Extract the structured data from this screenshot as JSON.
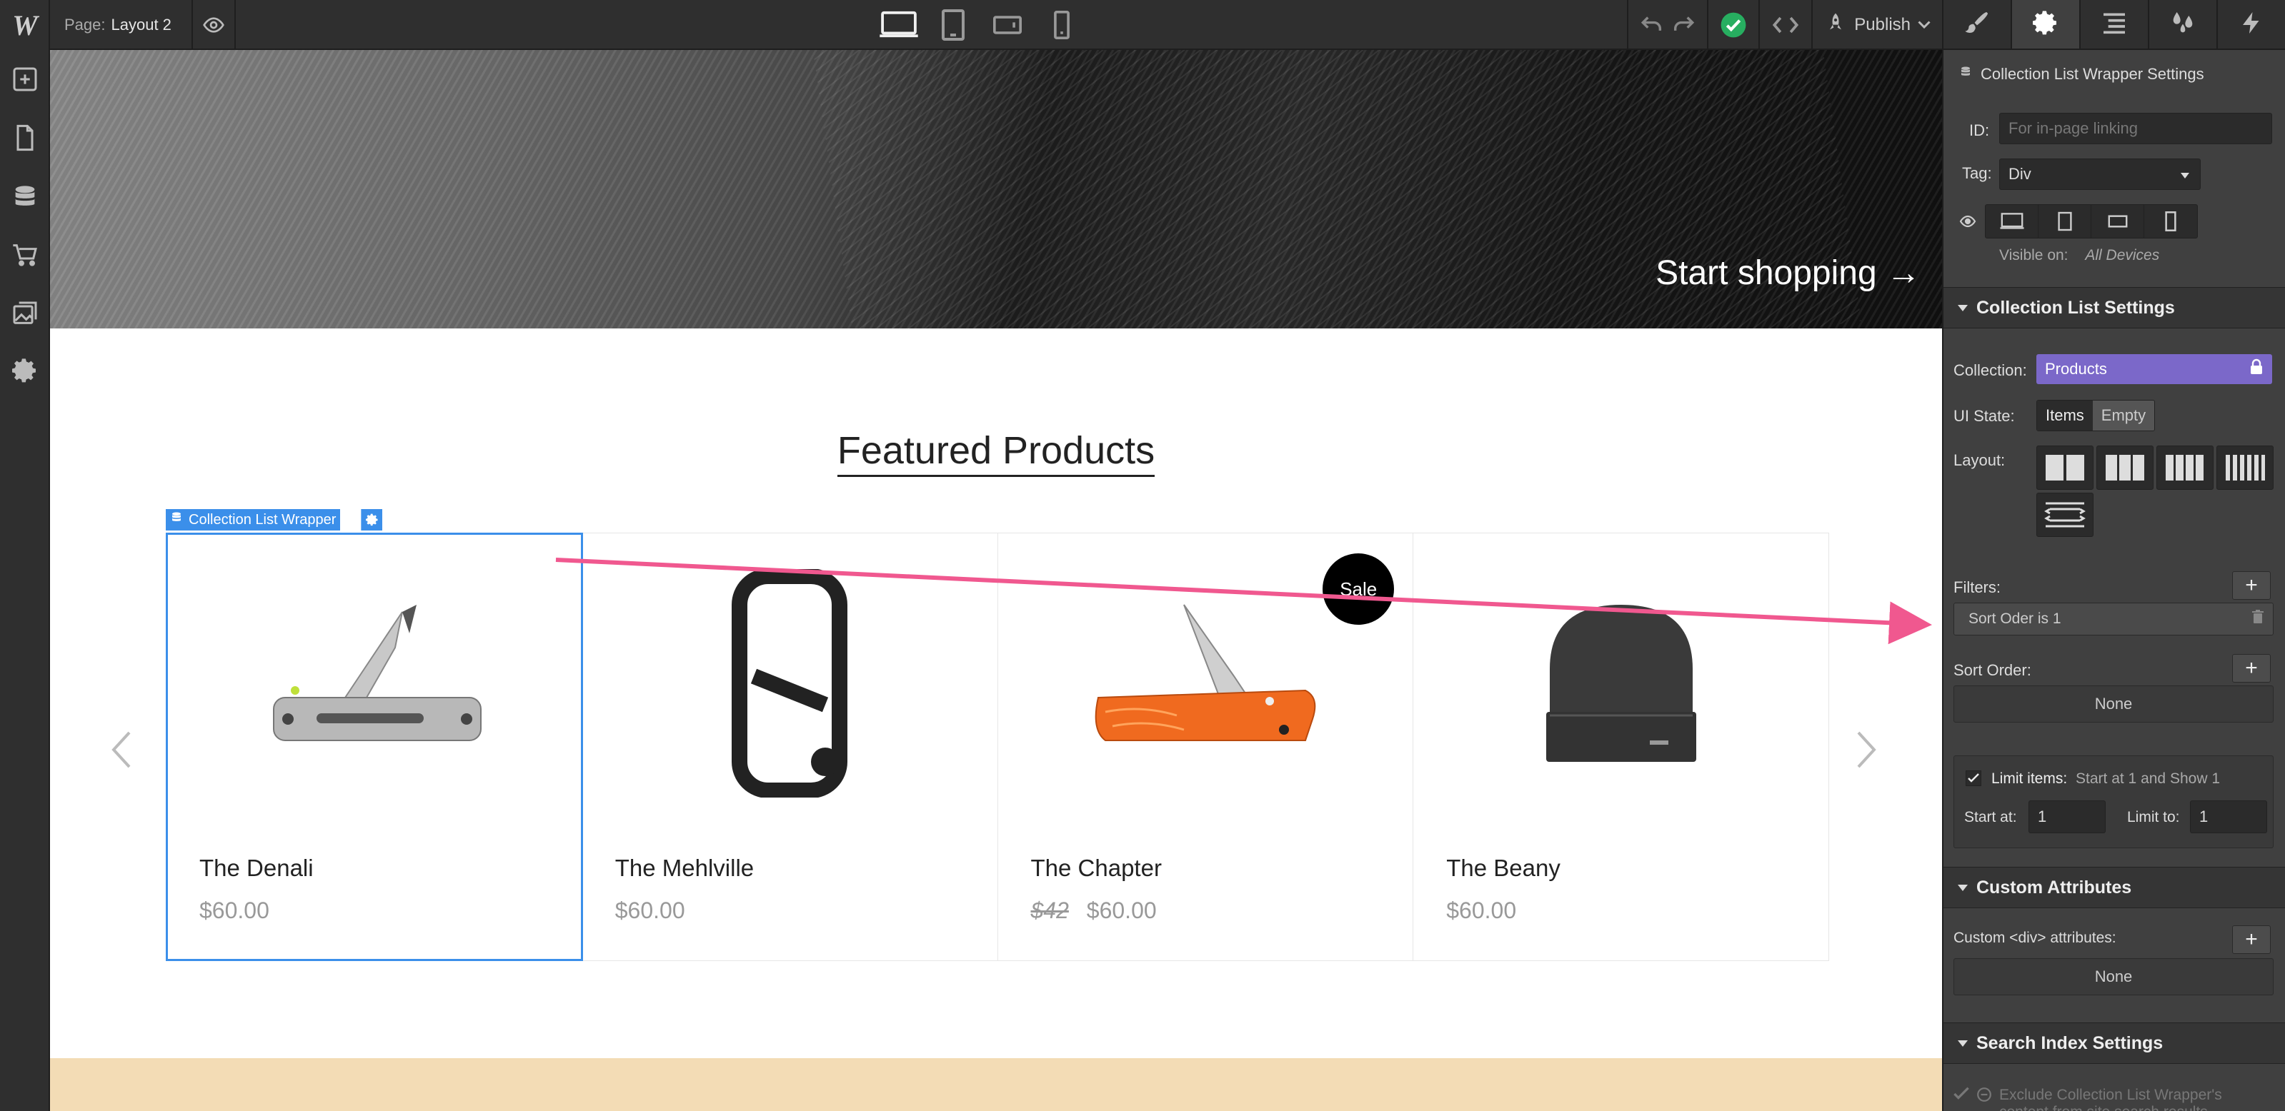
{
  "topbar": {
    "page_label": "Page:",
    "page_name": "Layout 2",
    "publish_label": "Publish"
  },
  "canvas": {
    "hero_cta": "Start shopping →",
    "section_title": "Featured Products",
    "selection_label": "Collection List Wrapper",
    "products": [
      {
        "name": "The Denali",
        "price": "$60.00",
        "old_price": ""
      },
      {
        "name": "The Mehlville",
        "price": "$60.00",
        "old_price": ""
      },
      {
        "name": "The Chapter",
        "price": "$60.00",
        "old_price": "$42",
        "badge": "Sale"
      },
      {
        "name": "The Beany",
        "price": "$60.00",
        "old_price": ""
      }
    ]
  },
  "panel": {
    "header_title": "Collection List Wrapper Settings",
    "id_label": "ID:",
    "id_placeholder": "For in-page linking",
    "tag_label": "Tag:",
    "tag_value": "Div",
    "visible_on_label": "Visible on:",
    "visible_on_value": "All Devices",
    "cls_title": "Collection List Settings",
    "collection_label": "Collection:",
    "collection_value": "Products",
    "ui_state_label": "UI State:",
    "ui_state_items": "Items",
    "ui_state_empty": "Empty",
    "layout_label": "Layout:",
    "filters_label": "Filters:",
    "filter_item": "Sort Oder is 1",
    "sort_label": "Sort Order:",
    "sort_value": "None",
    "limit_label": "Limit items:",
    "limit_summary": "Start at 1 and Show 1",
    "start_label": "Start at:",
    "start_value": "1",
    "limit_to_label": "Limit to:",
    "limit_to_value": "1",
    "custom_attr_title": "Custom Attributes",
    "custom_attr_label": "Custom <div> attributes:",
    "custom_attr_value": "None",
    "search_title": "Search Index Settings",
    "search_exclude": "Exclude Collection List Wrapper's content from site search results"
  },
  "colors": {
    "accent": "#3b8fea",
    "collection_purple": "#7b68c9",
    "annotation_pink": "#f0588f",
    "success_green": "#27ae60"
  }
}
